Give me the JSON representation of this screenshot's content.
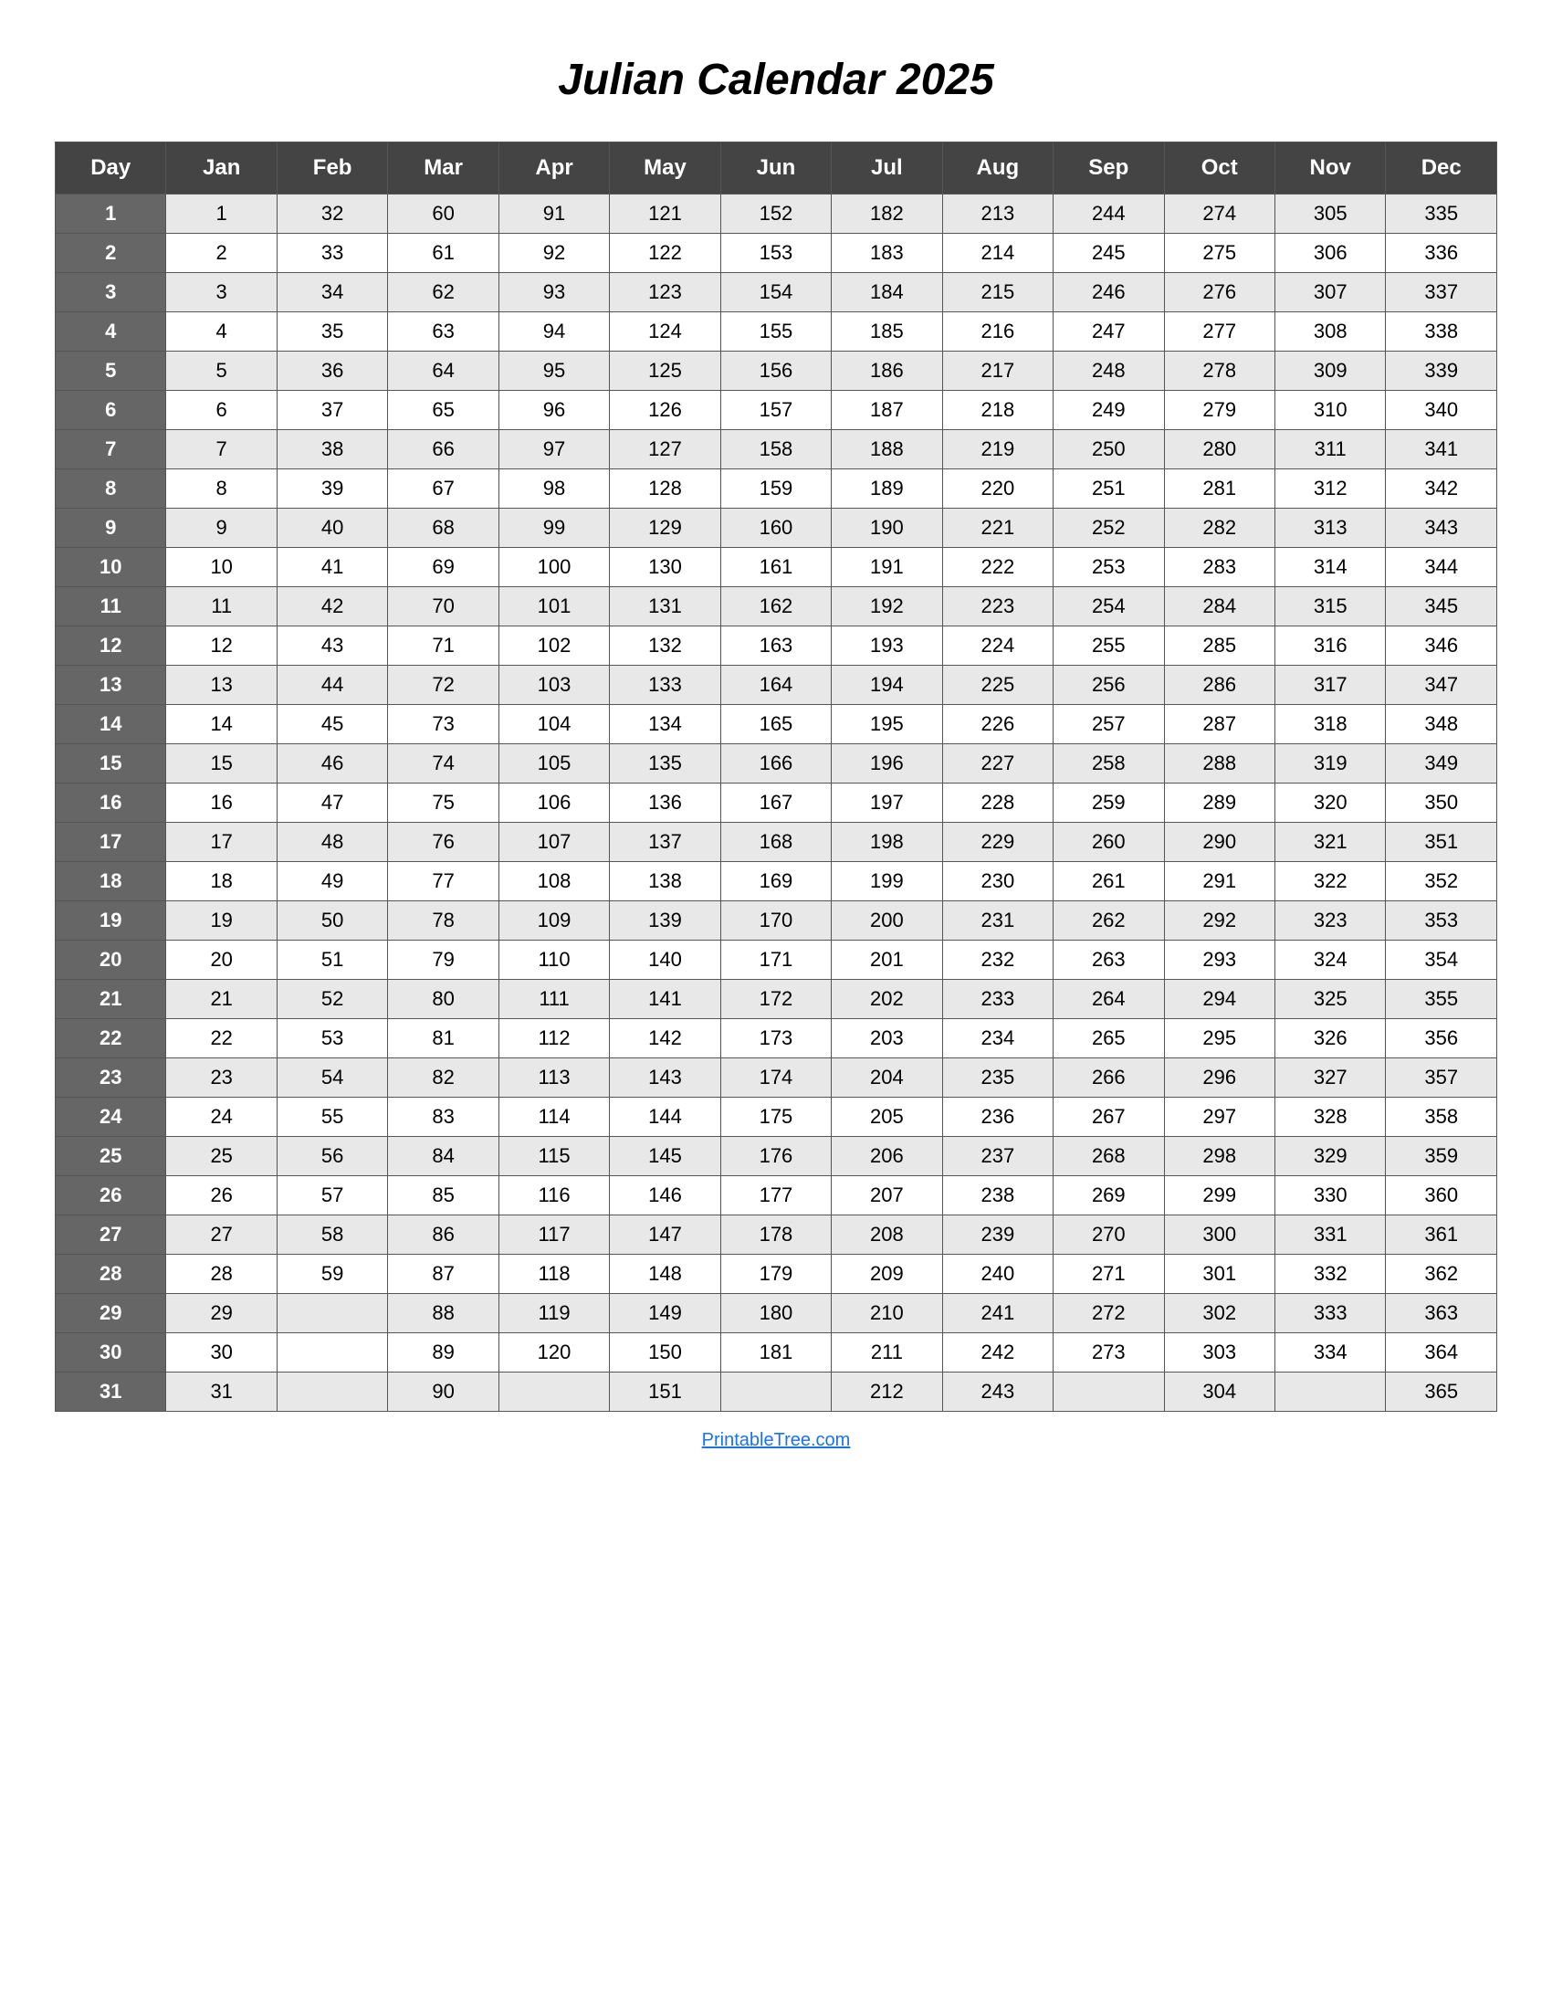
{
  "title": "Julian Calendar 2025",
  "footer": "PrintableTree.com",
  "columns": [
    "Day",
    "Jan",
    "Feb",
    "Mar",
    "Apr",
    "May",
    "Jun",
    "Jul",
    "Aug",
    "Sep",
    "Oct",
    "Nov",
    "Dec"
  ],
  "rows": [
    [
      1,
      1,
      32,
      60,
      91,
      121,
      152,
      182,
      213,
      244,
      274,
      305,
      335
    ],
    [
      2,
      2,
      33,
      61,
      92,
      122,
      153,
      183,
      214,
      245,
      275,
      306,
      336
    ],
    [
      3,
      3,
      34,
      62,
      93,
      123,
      154,
      184,
      215,
      246,
      276,
      307,
      337
    ],
    [
      4,
      4,
      35,
      63,
      94,
      124,
      155,
      185,
      216,
      247,
      277,
      308,
      338
    ],
    [
      5,
      5,
      36,
      64,
      95,
      125,
      156,
      186,
      217,
      248,
      278,
      309,
      339
    ],
    [
      6,
      6,
      37,
      65,
      96,
      126,
      157,
      187,
      218,
      249,
      279,
      310,
      340
    ],
    [
      7,
      7,
      38,
      66,
      97,
      127,
      158,
      188,
      219,
      250,
      280,
      311,
      341
    ],
    [
      8,
      8,
      39,
      67,
      98,
      128,
      159,
      189,
      220,
      251,
      281,
      312,
      342
    ],
    [
      9,
      9,
      40,
      68,
      99,
      129,
      160,
      190,
      221,
      252,
      282,
      313,
      343
    ],
    [
      10,
      10,
      41,
      69,
      100,
      130,
      161,
      191,
      222,
      253,
      283,
      314,
      344
    ],
    [
      11,
      11,
      42,
      70,
      101,
      131,
      162,
      192,
      223,
      254,
      284,
      315,
      345
    ],
    [
      12,
      12,
      43,
      71,
      102,
      132,
      163,
      193,
      224,
      255,
      285,
      316,
      346
    ],
    [
      13,
      13,
      44,
      72,
      103,
      133,
      164,
      194,
      225,
      256,
      286,
      317,
      347
    ],
    [
      14,
      14,
      45,
      73,
      104,
      134,
      165,
      195,
      226,
      257,
      287,
      318,
      348
    ],
    [
      15,
      15,
      46,
      74,
      105,
      135,
      166,
      196,
      227,
      258,
      288,
      319,
      349
    ],
    [
      16,
      16,
      47,
      75,
      106,
      136,
      167,
      197,
      228,
      259,
      289,
      320,
      350
    ],
    [
      17,
      17,
      48,
      76,
      107,
      137,
      168,
      198,
      229,
      260,
      290,
      321,
      351
    ],
    [
      18,
      18,
      49,
      77,
      108,
      138,
      169,
      199,
      230,
      261,
      291,
      322,
      352
    ],
    [
      19,
      19,
      50,
      78,
      109,
      139,
      170,
      200,
      231,
      262,
      292,
      323,
      353
    ],
    [
      20,
      20,
      51,
      79,
      110,
      140,
      171,
      201,
      232,
      263,
      293,
      324,
      354
    ],
    [
      21,
      21,
      52,
      80,
      111,
      141,
      172,
      202,
      233,
      264,
      294,
      325,
      355
    ],
    [
      22,
      22,
      53,
      81,
      112,
      142,
      173,
      203,
      234,
      265,
      295,
      326,
      356
    ],
    [
      23,
      23,
      54,
      82,
      113,
      143,
      174,
      204,
      235,
      266,
      296,
      327,
      357
    ],
    [
      24,
      24,
      55,
      83,
      114,
      144,
      175,
      205,
      236,
      267,
      297,
      328,
      358
    ],
    [
      25,
      25,
      56,
      84,
      115,
      145,
      176,
      206,
      237,
      268,
      298,
      329,
      359
    ],
    [
      26,
      26,
      57,
      85,
      116,
      146,
      177,
      207,
      238,
      269,
      299,
      330,
      360
    ],
    [
      27,
      27,
      58,
      86,
      117,
      147,
      178,
      208,
      239,
      270,
      300,
      331,
      361
    ],
    [
      28,
      28,
      59,
      87,
      118,
      148,
      179,
      209,
      240,
      271,
      301,
      332,
      362
    ],
    [
      29,
      29,
      "",
      88,
      119,
      149,
      180,
      210,
      241,
      272,
      302,
      333,
      363
    ],
    [
      30,
      30,
      "",
      89,
      120,
      150,
      181,
      211,
      242,
      273,
      303,
      334,
      364
    ],
    [
      31,
      31,
      "",
      90,
      "",
      151,
      "",
      212,
      243,
      "",
      304,
      "",
      365
    ]
  ]
}
